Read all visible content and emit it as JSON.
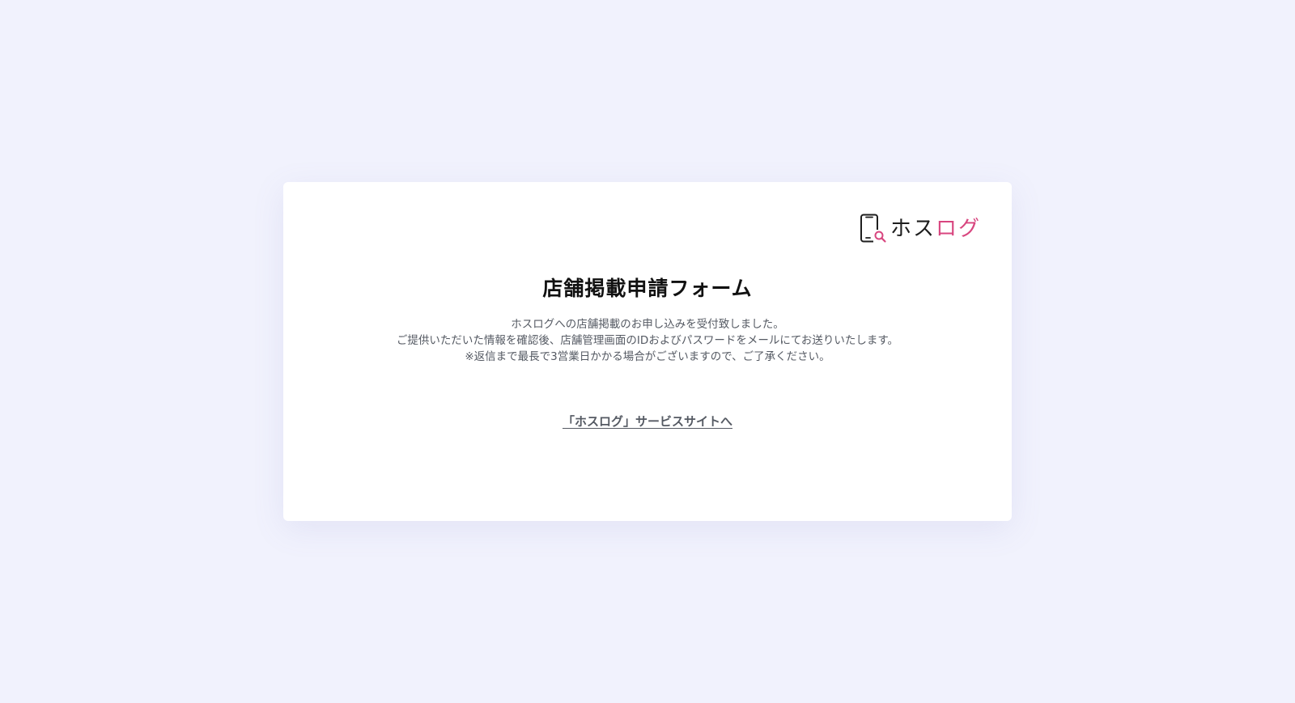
{
  "brand": {
    "logo_text_dark": "ホス",
    "logo_text_pink": "ログ",
    "logo_icon": "phone-search-icon",
    "colors": {
      "pink": "#d8467f",
      "dark": "#1e1e1e"
    }
  },
  "page": {
    "title": "店舗掲載申請フォーム",
    "message_lines": [
      "ホスログへの店舗掲載のお申し込みを受付致しました。",
      "ご提供いただいた情報を確認後、店舗管理画面のIDおよびパスワードをメールにてお送りいたします。",
      "※返信まで最長で3営業日かかる場合がございますので、ご了承ください。"
    ],
    "link_label": "「ホスログ」サービスサイトへ"
  },
  "colors": {
    "background": "#f1f2fd",
    "card": "#ffffff",
    "body_text": "#555a63"
  }
}
